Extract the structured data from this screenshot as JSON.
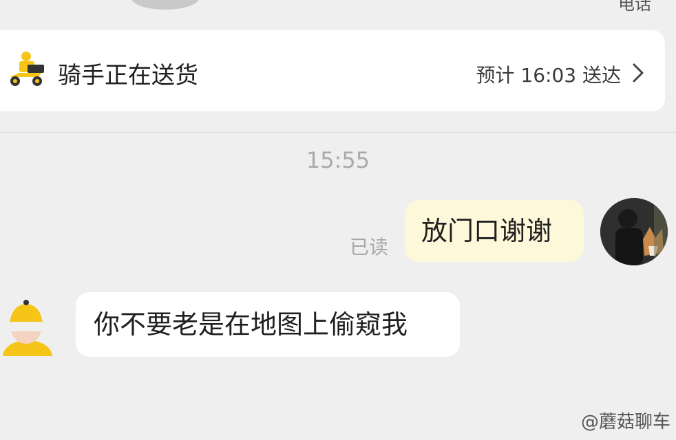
{
  "header": {
    "top_right_text": "电话"
  },
  "status_card": {
    "icon": "scooter-icon",
    "status": "骑手正在送货",
    "eta": "预计 16:03 送达"
  },
  "conversation": {
    "timestamp": "15:55",
    "messages": [
      {
        "from": "self",
        "text": "放门口谢谢",
        "status": "已读"
      },
      {
        "from": "rider",
        "text": "你不要老是在地图上偷窥我"
      }
    ]
  },
  "watermark": "@蘑菇聊车",
  "colors": {
    "background": "#efefef",
    "card": "#ffffff",
    "sent_bubble": "#fdf8d9",
    "accent_yellow": "#f5c518"
  }
}
